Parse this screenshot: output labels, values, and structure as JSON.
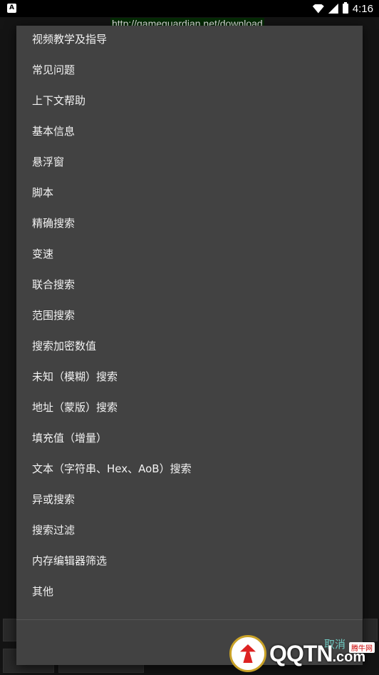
{
  "status_bar": {
    "time": "4:16",
    "left_icon": "A"
  },
  "background": {
    "url_text": "http://gameguardian.net/download"
  },
  "menu": {
    "items": [
      "视频教学及指导",
      "常见问题",
      "上下文帮助",
      "基本信息",
      "悬浮窗",
      "脚本",
      "精确搜索",
      "变速",
      "联合搜索",
      "范围搜索",
      "搜索加密数值",
      "未知（模糊）搜索",
      "地址（蒙版）搜索",
      "填充值（增量）",
      "文本（字符串、Hex、AoB）搜索",
      "异或搜索",
      "搜索过滤",
      "内存编辑器筛选",
      "其他"
    ],
    "cancel_label": "取消"
  },
  "watermark": {
    "brand": "QQTN",
    "suffix": ".com",
    "badge": "腾牛网"
  }
}
